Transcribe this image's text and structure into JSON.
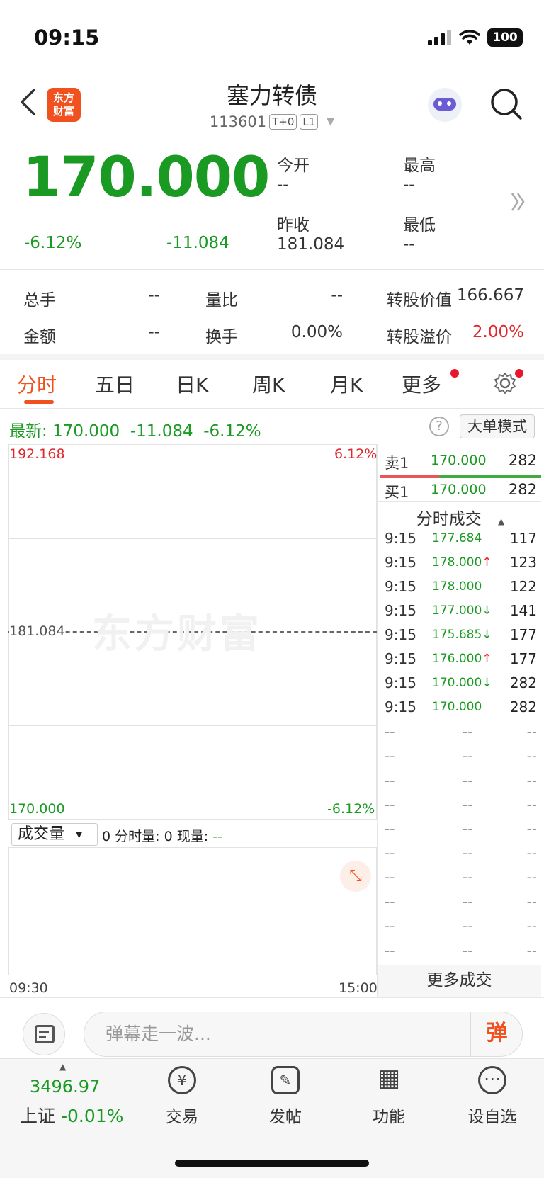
{
  "status": {
    "time": "09:15",
    "battery": "100"
  },
  "header": {
    "title": "塞力转债",
    "code": "113601",
    "tag1": "T+0",
    "tag2": "L1",
    "logo_line1": "东方",
    "logo_line2": "财富"
  },
  "quote": {
    "last": "170.000",
    "change_pct": "-6.12%",
    "change_amt": "-11.084",
    "open_label": "今开",
    "open_val": "--",
    "high_label": "最高",
    "high_val": "--",
    "prev_label": "昨收",
    "prev_val": "181.084",
    "low_label": "最低",
    "low_val": "--"
  },
  "stats": {
    "vol_label": "总手",
    "vol_val": "--",
    "ratio_label": "量比",
    "ratio_val": "--",
    "conv_value_label": "转股价值",
    "conv_value_val": "166.667",
    "amount_label": "金额",
    "amount_val": "--",
    "turnover_label": "换手",
    "turnover_val": "0.00%",
    "premium_label": "转股溢价",
    "premium_val": "2.00%"
  },
  "tabs": [
    "分时",
    "五日",
    "日K",
    "周K",
    "月K",
    "更多"
  ],
  "latest": {
    "label": "最新:",
    "price": "170.000",
    "chg": "-11.084",
    "pct": "-6.12%"
  },
  "mode_button": "大单模式",
  "chart": {
    "y_top": "192.168",
    "y_top_pct": "6.12%",
    "y_mid": "181.084",
    "y_bottom": "170.000",
    "y_bottom_pct": "-6.12%",
    "watermark": "东方财富",
    "time_start": "09:30",
    "time_end": "15:00"
  },
  "volume": {
    "select": "成交量",
    "info_prefix": "0 分时量: 0 现量: ",
    "info_val": "--"
  },
  "orderbook": {
    "sell_label": "卖1",
    "sell_price": "170.000",
    "sell_vol": "282",
    "buy_label": "买1",
    "buy_price": "170.000",
    "buy_vol": "282"
  },
  "ticks_title": "分时成交",
  "ticks": [
    {
      "time": "9:15",
      "price": "177.684",
      "dir": "",
      "vol": "117"
    },
    {
      "time": "9:15",
      "price": "178.000",
      "dir": "↑",
      "vol": "123"
    },
    {
      "time": "9:15",
      "price": "178.000",
      "dir": "",
      "vol": "122"
    },
    {
      "time": "9:15",
      "price": "177.000",
      "dir": "↓",
      "vol": "141"
    },
    {
      "time": "9:15",
      "price": "175.685",
      "dir": "↓",
      "vol": "177"
    },
    {
      "time": "9:15",
      "price": "176.000",
      "dir": "↑",
      "vol": "177"
    },
    {
      "time": "9:15",
      "price": "170.000",
      "dir": "↓",
      "vol": "282"
    },
    {
      "time": "9:15",
      "price": "170.000",
      "dir": "",
      "vol": "282"
    }
  ],
  "placeholder_cell": "--",
  "more_trades": "更多成交",
  "comment": {
    "placeholder": "弹幕走一波...",
    "send": "弹"
  },
  "index": {
    "value": "3496.97",
    "name": "上证",
    "pct": "-0.01%"
  },
  "nav": [
    {
      "label": "交易",
      "icon": "¥"
    },
    {
      "label": "发帖",
      "icon": "✎"
    },
    {
      "label": "功能",
      "icon": "▦"
    },
    {
      "label": "设自选",
      "icon": "⋯"
    }
  ]
}
